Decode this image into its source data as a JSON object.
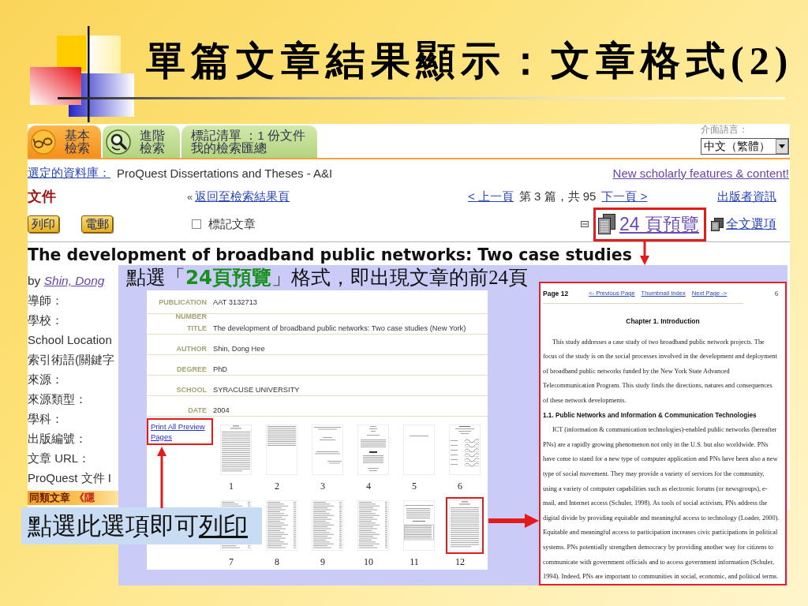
{
  "slide": {
    "title": "單篇文章結果顯示：文章格式(2)"
  },
  "browser": {
    "tabs": [
      {
        "kind": "glasses",
        "lines": [
          "基本",
          "檢索"
        ],
        "selected": true
      },
      {
        "kind": "magnifier",
        "lines": [
          "進階",
          "檢索"
        ],
        "selected": false
      },
      {
        "kind": "text",
        "lines": [
          "標記清單 ：1 份文件",
          "我的檢索匯總"
        ],
        "selected": false
      }
    ],
    "language": {
      "label": "介面語言：",
      "value": "中文（繁體）"
    },
    "database": {
      "label": "選定的資料庫：",
      "value": "ProQuest Dissertations and Theses - A&I"
    },
    "news_link": "New scholarly features & content!",
    "section_heading": "文件",
    "back": {
      "mark": "«",
      "link": "返回至檢索結果頁"
    },
    "pager": {
      "previous": "< 上一頁",
      "position": "第 3 篇，共 95",
      "next": "下一頁 >"
    },
    "publisher_link": "出版者資訊",
    "buttons": [
      "列印",
      "電郵"
    ],
    "mark_article": {
      "label": "標記文章",
      "checked": false
    },
    "formats": [
      {
        "kind": "preview",
        "label": "24 頁預覽",
        "highlighted": true
      },
      {
        "kind": "full-text",
        "label": "全文選項",
        "highlighted": false
      }
    ],
    "article_title": "The development of broadband public networks: Two case studies",
    "byline": {
      "prefix": "by",
      "author": "Shin, Dong"
    },
    "fields": [
      "導師：",
      "學校：",
      "School Location",
      "索引術語(關鍵字",
      "來源：",
      "來源類型：",
      "學科：",
      "出版編號：",
      "文章 URL：",
      "ProQuest 文件 I"
    ],
    "related": {
      "label": "同類文章",
      "link": "《隱"
    }
  },
  "preview": {
    "caption": "點選「**24頁預覽**」格式，即出現文章的前24頁",
    "record": [
      {
        "label": "PUBLICATION NUMBER",
        "value": "AAT 3132713"
      },
      {
        "label": "TITLE",
        "value": "The development of broadband public networks: Two case studies (New York)"
      },
      {
        "label": "AUTHOR",
        "value": "Shin, Dong Hee"
      },
      {
        "label": "DEGREE",
        "value": "PhD"
      },
      {
        "label": "SCHOOL",
        "value": "SYRACUSE UNIVERSITY"
      },
      {
        "label": "DATE",
        "value": "2004"
      }
    ],
    "print_link": {
      "label": "Print All Preview Pages",
      "highlighted": true
    },
    "thumbnails": [
      {
        "number": "1",
        "kind": "text",
        "highlighted": false
      },
      {
        "number": "2",
        "kind": "top-text",
        "highlighted": false
      },
      {
        "number": "3",
        "kind": "sparse",
        "highlighted": false
      },
      {
        "number": "4",
        "kind": "title",
        "highlighted": false
      },
      {
        "number": "5",
        "kind": "blank",
        "highlighted": false
      },
      {
        "number": "6",
        "kind": "form",
        "highlighted": false
      },
      {
        "number": "7",
        "kind": "list",
        "highlighted": false
      },
      {
        "number": "8",
        "kind": "list",
        "highlighted": false
      },
      {
        "number": "9",
        "kind": "list",
        "highlighted": false
      },
      {
        "number": "10",
        "kind": "list",
        "highlighted": false
      },
      {
        "number": "11",
        "kind": "table",
        "highlighted": false
      },
      {
        "number": "12",
        "kind": "text",
        "highlighted": true
      }
    ]
  },
  "page_view": {
    "page_label": "Page 12",
    "links": [
      "<- Previous Page",
      "Thumbnail Index",
      "Next Page ->"
    ],
    "page_number": "6",
    "chapter": "Chapter 1. Introduction",
    "blocks": [
      {
        "kind": "paragraph",
        "lines": [
          "This study addresses a case study of two broadband public network projects. The",
          "focus of the study is on the social processes involved in the development and deployment",
          "of broadband public networks funded by the New York State Advanced",
          "Telecommunication Program. This study finds the directions, natures and consequences",
          "of these network developments."
        ]
      },
      {
        "kind": "heading",
        "text": "1.1. Public Networks and Information & Communication Technologies"
      },
      {
        "kind": "paragraph",
        "lines": [
          "ICT (information & communication technologies)-enabled public networks (hereafter",
          "PNs) are a rapidly growing phenomenon not only in the U.S. but also worldwide. PNs",
          "have come to stand for a new type of computer application and PNs have been also a new",
          "type of social movement. They may provide a variety of services for the community,",
          "using a variety of computer capabilities such as electronic forums (or newsgroups), e-",
          "mail, and Internet access (Schuler, 1998). As tools of social activism, PNs address the",
          "digital divide by providing equitable and meaningful access to technology (Loader, 2000).",
          "Equitable and meaningful access to participation increases civic participations in political",
          "systems. PNs potentially strengthen democracy by providing another way for citizens to",
          "communicate with government officials and to access government information (Schuler,",
          "1994). Indeed, PNs are important to communities in social, economic, and political terms."
        ]
      }
    ]
  },
  "callout": {
    "text": "點選此選項即可",
    "underlined": "列印"
  }
}
